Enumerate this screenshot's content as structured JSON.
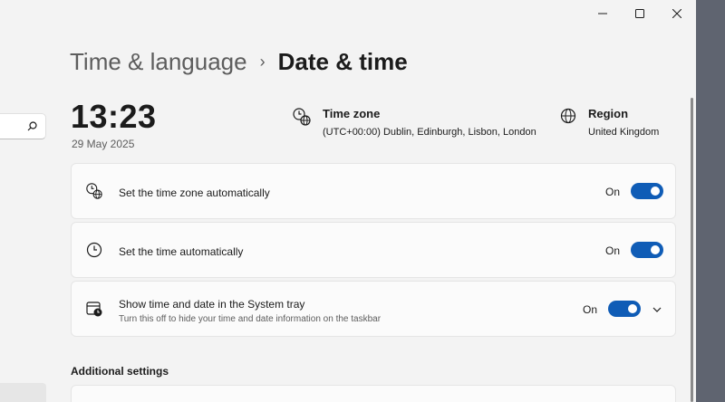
{
  "window": {
    "caption": {
      "minimize_icon": "minimize-icon",
      "maximize_icon": "maximize-icon",
      "close_icon": "close-icon"
    }
  },
  "search": {
    "icon": "search-icon",
    "value": ""
  },
  "breadcrumb": {
    "parent": "Time & language",
    "separator": "›",
    "current": "Date & time"
  },
  "clock": {
    "time": "13:23",
    "date": "29 May 2025"
  },
  "timezone_info": {
    "title": "Time zone",
    "value": "(UTC+00:00) Dublin, Edinburgh, Lisbon, London",
    "icon": "clock-globe-icon"
  },
  "region_info": {
    "title": "Region",
    "value": "United Kingdom",
    "icon": "globe-icon"
  },
  "settings": [
    {
      "label": "Set the time zone automatically",
      "state": "On",
      "icon": "clock-globe-icon",
      "toggle_on": true
    },
    {
      "label": "Set the time automatically",
      "state": "On",
      "icon": "clock-icon",
      "toggle_on": true
    },
    {
      "label": "Show time and date in the System tray",
      "description": "Turn this off to hide your time and date information on the taskbar",
      "state": "On",
      "icon": "calendar-clock-icon",
      "toggle_on": true,
      "expand_icon": "chevron-down-icon"
    }
  ],
  "additional": {
    "title": "Additional settings"
  },
  "colors": {
    "accent": "#0f5cb6",
    "background": "#f3f3f3",
    "card": "#fbfbfb"
  }
}
